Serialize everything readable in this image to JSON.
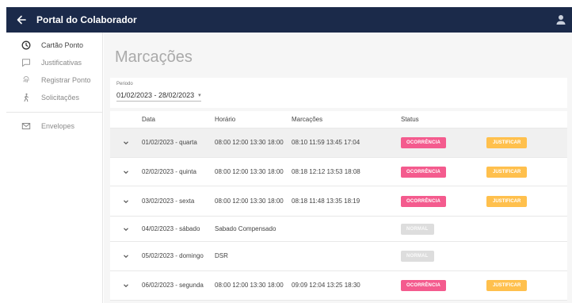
{
  "header": {
    "title": "Portal do Colaborador"
  },
  "sidebar": {
    "items": [
      {
        "label": "Cartão Ponto"
      },
      {
        "label": "Justificativas"
      },
      {
        "label": "Registrar Ponto"
      },
      {
        "label": "Solicitações"
      },
      {
        "label": "Envelopes"
      }
    ]
  },
  "main": {
    "title": "Marcações",
    "period": {
      "label": "Periodo",
      "value": "01/02/2023 - 28/02/2023"
    },
    "columns": {
      "date": "Data",
      "schedule": "Horário",
      "marks": "Marcações",
      "status": "Status"
    },
    "action_label": "JUSTIFICAR",
    "rows": [
      {
        "date": "01/02/2023 - quarta",
        "schedule": "08:00 12:00 13:30 18:00",
        "marks": "08:10 11:59 13:45 17:04",
        "status": "OCORRÊNCIA"
      },
      {
        "date": "02/02/2023 - quinta",
        "schedule": "08:00 12:00 13:30 18:00",
        "marks": "08:18 12:12 13:53 18:08",
        "status": "OCORRÊNCIA"
      },
      {
        "date": "03/02/2023 - sexta",
        "schedule": "08:00 12:00 13:30 18:00",
        "marks": "08:18 11:48 13:35 18:19",
        "status": "OCORRÊNCIA"
      },
      {
        "date": "04/02/2023 - sábado",
        "schedule": "Sabado Compensado",
        "marks": "",
        "status": "NORMAL"
      },
      {
        "date": "05/02/2023 - domingo",
        "schedule": "DSR",
        "marks": "",
        "status": "NORMAL"
      },
      {
        "date": "06/02/2023 - segunda",
        "schedule": "08:00 12:00 13:30 18:00",
        "marks": "09:09 12:04 13:25 18:30",
        "status": "OCORRÊNCIA"
      }
    ]
  },
  "colors": {
    "topbar": "#1b2a4a",
    "ocorrencia": "#f45b8e",
    "justificar": "#ffc04d",
    "normal": "#dddddd"
  }
}
